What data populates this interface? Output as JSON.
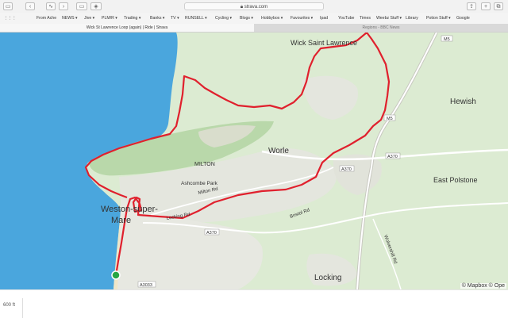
{
  "browser": {
    "url": "strava.com",
    "bookmarks": [
      "From Ache",
      "NEWS ▾",
      "Jive ▾",
      "PLM/R ▾",
      "Trading ▾",
      "Banks ▾",
      "TV ▾",
      "RUNSELL ▾",
      "Cycling ▾",
      "Blogs ▾",
      "Hobbybox ▾",
      "Favourites ▾",
      "Ipad",
      "YouTube",
      "Times",
      "Weebz Stuff ▾",
      "Library",
      "Potion Stuff ▾",
      "Google"
    ],
    "tabs": {
      "active": "Wick St Lawrence Loop (again) | Ride | Strava",
      "inactive": "Regions - BBC News"
    }
  },
  "map": {
    "labels": {
      "wick": "Wick Saint Lawrence",
      "hewish": "Hewish",
      "worle": "Worle",
      "milton": "MILTON",
      "ashcombe": "Ashcombe Park",
      "east_polstone": "East Polstone",
      "weston1": "Weston-super-",
      "weston2": "Mare",
      "locking": "Locking",
      "milton_rd": "Milton Rd",
      "locking_rd": "Locking Rd",
      "wolvershill": "Wolvershill Rd",
      "m5a": "M5",
      "m5b": "M5",
      "a370a": "A370",
      "a370b": "A370",
      "a370c": "A370",
      "a3033": "A3033",
      "bristol_rd": "Bristol Rd"
    },
    "attribution": "© Mapbox © Ope"
  },
  "elevation": {
    "axis_label": "600 ft"
  },
  "colors": {
    "route": "#e0202d",
    "sea": "#4aa6dd",
    "land": "#dcebd2",
    "start": "#28a745"
  }
}
